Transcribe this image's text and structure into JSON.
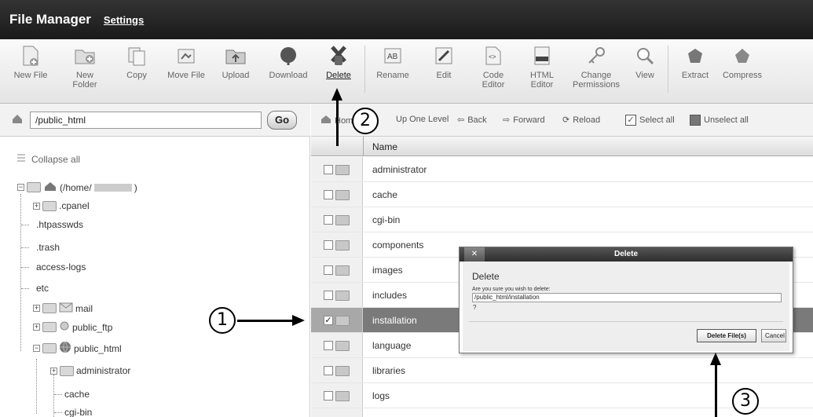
{
  "header": {
    "title": "File Manager",
    "settings_link": "Settings"
  },
  "toolbar": {
    "items": [
      {
        "label": "New File",
        "icon": "new-file-icon"
      },
      {
        "label": "New\nFolder",
        "icon": "new-folder-icon"
      },
      {
        "label": "Copy",
        "icon": "copy-icon"
      },
      {
        "label": "Move File",
        "icon": "move-file-icon"
      },
      {
        "label": "Upload",
        "icon": "upload-icon"
      },
      {
        "label": "Download",
        "icon": "download-icon"
      },
      {
        "label": "Delete",
        "icon": "delete-icon"
      },
      {
        "label": "Rename",
        "icon": "rename-icon"
      },
      {
        "label": "Edit",
        "icon": "edit-icon"
      },
      {
        "label": "Code\nEditor",
        "icon": "code-editor-icon"
      },
      {
        "label": "HTML\nEditor",
        "icon": "html-editor-icon"
      },
      {
        "label": "Change\nPermissions",
        "icon": "change-permissions-icon"
      },
      {
        "label": "View",
        "icon": "view-icon"
      },
      {
        "label": "Extract",
        "icon": "extract-icon"
      },
      {
        "label": "Compress",
        "icon": "compress-icon"
      }
    ]
  },
  "path": {
    "value": "/public_html",
    "go_label": "Go"
  },
  "tree": {
    "collapse_label": "Collapse all",
    "root_label": "(/home/",
    "root_suffix": ")",
    "items": [
      ".cpanel",
      ".htpasswds",
      ".trash",
      "access-logs",
      "etc",
      "mail",
      "public_ftp",
      "public_html",
      "administrator",
      "cache",
      "cgi-bin"
    ]
  },
  "nav": {
    "home_label": "Hom",
    "up_label": "Up One Level",
    "back_label": "Back",
    "forward_label": "Forward",
    "reload_label": "Reload",
    "select_all_label": "Select all",
    "unselect_all_label": "Unselect all"
  },
  "files": {
    "header_name": "Name",
    "rows": [
      "administrator",
      "cache",
      "cgi-bin",
      "components",
      "images",
      "includes",
      "installation",
      "language",
      "libraries",
      "logs"
    ],
    "selected": "installation"
  },
  "dialog": {
    "close_label": "✕",
    "title": "Delete",
    "heading": "Delete",
    "message": "Are you sure you wish to delete:",
    "path": "/public_html/installation",
    "question": "?",
    "confirm_label": "Delete File(s)",
    "cancel_label": "Cancel"
  },
  "annotations": {
    "step1": "1",
    "step2": "2",
    "step3": "3"
  }
}
